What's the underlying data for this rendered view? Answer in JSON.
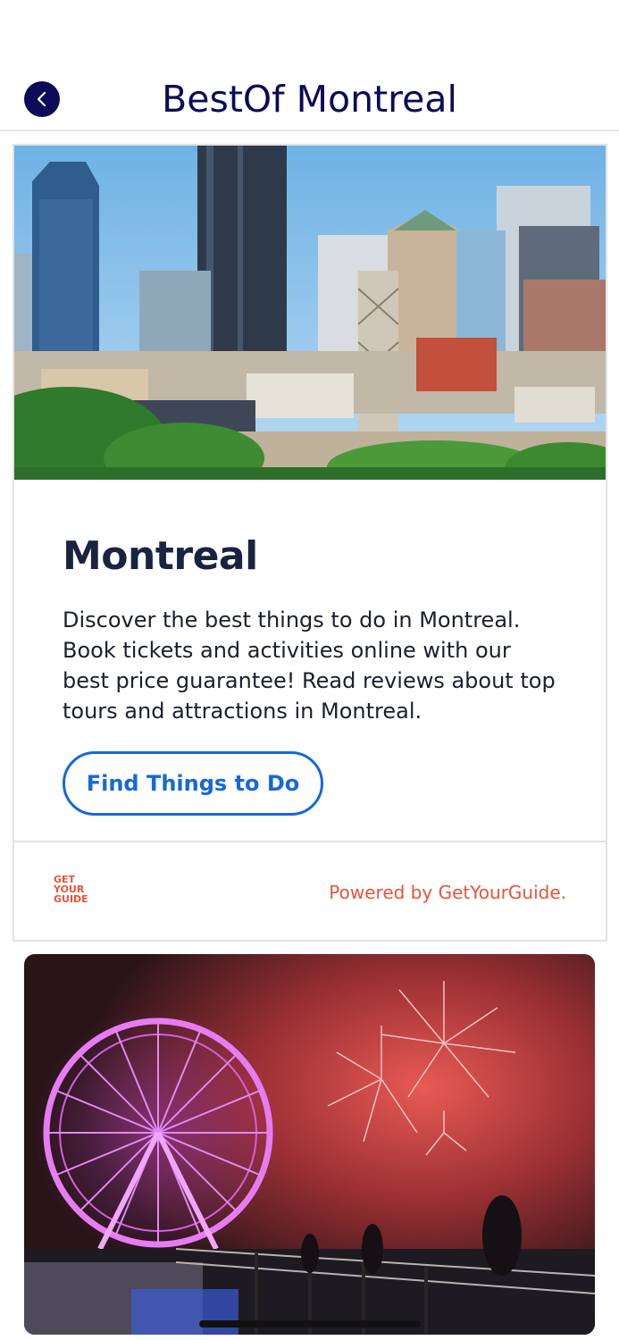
{
  "header": {
    "title": "BestOf Montreal",
    "back_icon": "chevron-left-icon"
  },
  "card": {
    "hero_image": "montreal-skyline-photo",
    "city_name": "Montreal",
    "description": "Discover the best things to do in Montreal. Book tickets and activities online with our best price guarantee! Read reviews about top tours and attractions in Montreal.",
    "button_label": "Find Things to Do",
    "logo_text": [
      "GET",
      "YOUR",
      "GUIDE"
    ],
    "powered_by": "Powered by GetYourGuide."
  },
  "second_image": "ferris-wheel-fireworks-photo",
  "colors": {
    "brand_navy": "#0b0b5a",
    "button_blue": "#1469d6",
    "gyg_orange": "#e8533a"
  }
}
